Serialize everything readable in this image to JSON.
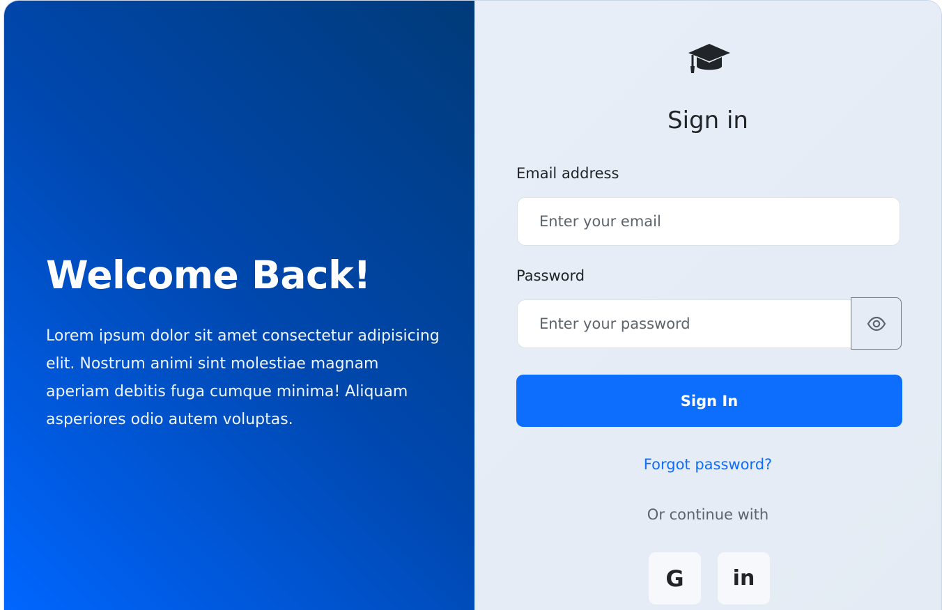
{
  "welcome": {
    "title": "Welcome Back!",
    "text": "Lorem ipsum dolor sit amet consectetur adipisicing elit. Nostrum animi sint molestiae magnam aperiam debitis fuga cumque minima! Aliquam asperiores odio autem voluptas."
  },
  "signin": {
    "logo_icon": "graduation-cap-icon",
    "title": "Sign in",
    "email_label": "Email address",
    "email_placeholder": "Enter your email",
    "email_value": "",
    "password_label": "Password",
    "password_placeholder": "Enter your password",
    "password_value": "",
    "toggle_icon": "eye-icon",
    "submit_label": "Sign In",
    "forgot_label": "Forgot password?",
    "continue_label": "Or continue with"
  },
  "social": [
    {
      "label": "G",
      "icon": "google-icon"
    },
    {
      "label": "in",
      "icon": "linkedin-icon"
    }
  ],
  "colors": {
    "primary": "#0d6efd",
    "gradient_start": "#0066ff",
    "gradient_end": "#003a78",
    "right_bg": "#e6ecf6"
  }
}
